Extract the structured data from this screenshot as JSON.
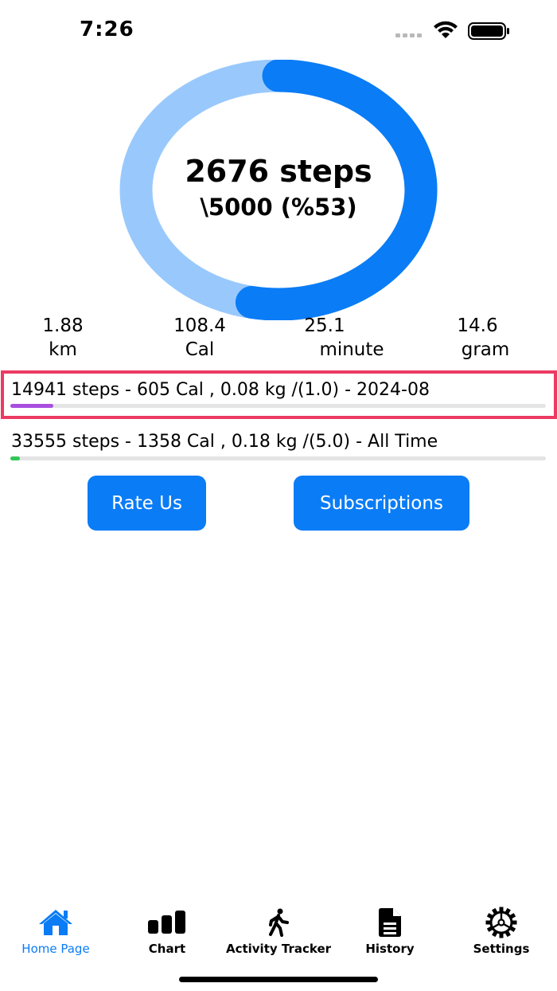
{
  "status": {
    "time": "7:26"
  },
  "ring": {
    "steps": "2676 steps",
    "goal": "\\5000 (%53)",
    "progress": 0.53
  },
  "stats": [
    {
      "value": "1.88",
      "unit": "km"
    },
    {
      "value": "108.4",
      "unit": "Cal"
    },
    {
      "value": "25.1",
      "unit": "minute"
    },
    {
      "value": "14.6",
      "unit": "gram"
    }
  ],
  "progress_rows": [
    {
      "label": "14941 steps - 605 Cal , 0.08 kg /(1.0) - 2024-08",
      "fraction": 0.08,
      "color": "#a84fe0"
    },
    {
      "label": "33555 steps - 1358 Cal , 0.18 kg /(5.0) - All Time",
      "fraction": 0.018,
      "color": "#33c659"
    }
  ],
  "buttons": {
    "rate": "Rate Us",
    "subscriptions": "Subscriptions"
  },
  "tabs": [
    {
      "label": "Home Page",
      "icon": "house-icon",
      "active": true
    },
    {
      "label": "Chart",
      "icon": "chart-bars-icon",
      "active": false
    },
    {
      "label": "Activity Tracker",
      "icon": "walking-figure-icon",
      "active": false
    },
    {
      "label": "History",
      "icon": "document-icon",
      "active": false
    },
    {
      "label": "Settings",
      "icon": "gear-icon",
      "active": false
    }
  ],
  "colors": {
    "accent": "#0a7cf6",
    "ring_light": "#99c9fc",
    "highlight": "#ec3b63"
  }
}
